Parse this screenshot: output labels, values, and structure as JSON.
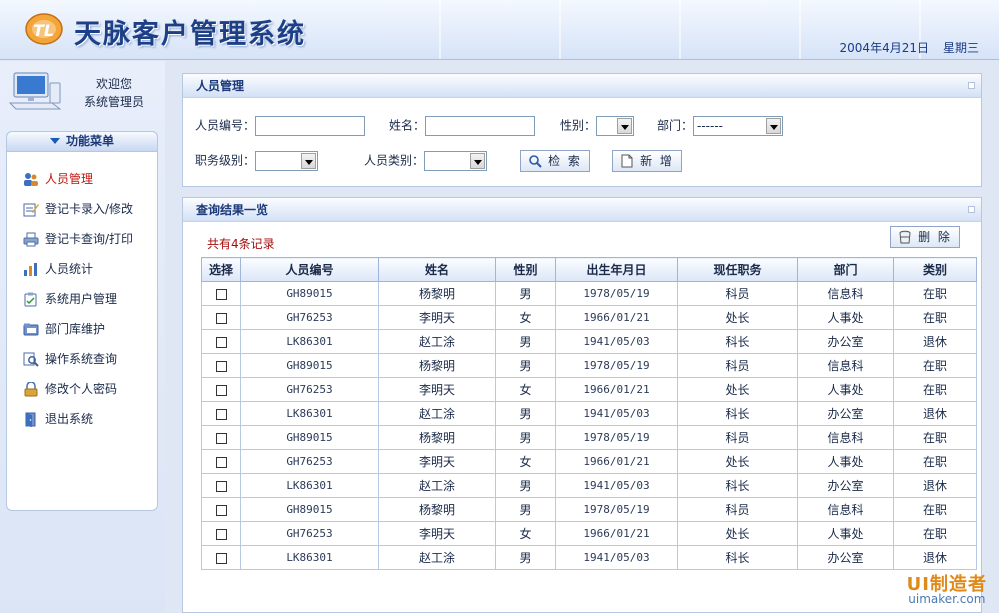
{
  "header": {
    "title": "天脉客户管理系统",
    "date": "2004年4月21日",
    "weekday": "星期三"
  },
  "sidebar": {
    "welcome_line1": "欢迎您",
    "welcome_line2": "系统管理员",
    "menu_title": "功能菜单",
    "items": [
      {
        "label": "人员管理",
        "icon": "users-icon"
      },
      {
        "label": "登记卡录入/修改",
        "icon": "edit-icon"
      },
      {
        "label": "登记卡查询/打印",
        "icon": "print-icon"
      },
      {
        "label": "人员统计",
        "icon": "chart-icon"
      },
      {
        "label": "系统用户管理",
        "icon": "clipboard-icon"
      },
      {
        "label": "部门库维护",
        "icon": "folder-icon"
      },
      {
        "label": "操作系统查询",
        "icon": "search-icon"
      },
      {
        "label": "修改个人密码",
        "icon": "lock-icon"
      },
      {
        "label": "退出系统",
        "icon": "exit-icon"
      }
    ]
  },
  "search": {
    "title": "人员管理",
    "emp_id_label": "人员编号：",
    "name_label": "姓名：",
    "gender_label": "性别：",
    "dept_label": "部门：",
    "dept_value": "------",
    "grade_label": "职务级别：",
    "category_label": "人员类别：",
    "search_button": "检 索",
    "add_button": "新 增"
  },
  "results": {
    "title": "查询结果一览",
    "count_text": "共有4条记录",
    "delete_button": "删 除",
    "columns": [
      "选择",
      "人员编号",
      "姓名",
      "性别",
      "出生年月日",
      "现任职务",
      "部门",
      "类别"
    ],
    "rows": [
      [
        "GH89015",
        "杨黎明",
        "男",
        "1978/05/19",
        "科员",
        "信息科",
        "在职"
      ],
      [
        "GH76253",
        "李明天",
        "女",
        "1966/01/21",
        "处长",
        "人事处",
        "在职"
      ],
      [
        "LK86301",
        "赵工涂",
        "男",
        "1941/05/03",
        "科长",
        "办公室",
        "退休"
      ],
      [
        "GH89015",
        "杨黎明",
        "男",
        "1978/05/19",
        "科员",
        "信息科",
        "在职"
      ],
      [
        "GH76253",
        "李明天",
        "女",
        "1966/01/21",
        "处长",
        "人事处",
        "在职"
      ],
      [
        "LK86301",
        "赵工涂",
        "男",
        "1941/05/03",
        "科长",
        "办公室",
        "退休"
      ],
      [
        "GH89015",
        "杨黎明",
        "男",
        "1978/05/19",
        "科员",
        "信息科",
        "在职"
      ],
      [
        "GH76253",
        "李明天",
        "女",
        "1966/01/21",
        "处长",
        "人事处",
        "在职"
      ],
      [
        "LK86301",
        "赵工涂",
        "男",
        "1941/05/03",
        "科长",
        "办公室",
        "退休"
      ],
      [
        "GH89015",
        "杨黎明",
        "男",
        "1978/05/19",
        "科员",
        "信息科",
        "在职"
      ],
      [
        "GH76253",
        "李明天",
        "女",
        "1966/01/21",
        "处长",
        "人事处",
        "在职"
      ],
      [
        "LK86301",
        "赵工涂",
        "男",
        "1941/05/03",
        "科长",
        "办公室",
        "退休"
      ]
    ]
  },
  "watermark": {
    "line1": "UI制造者",
    "line2": "uimaker.com"
  },
  "colors": {
    "accent": "#1c3a7a",
    "active_menu": "#c0140c",
    "count_text": "#a50e0e",
    "border": "#b6c6e3"
  }
}
